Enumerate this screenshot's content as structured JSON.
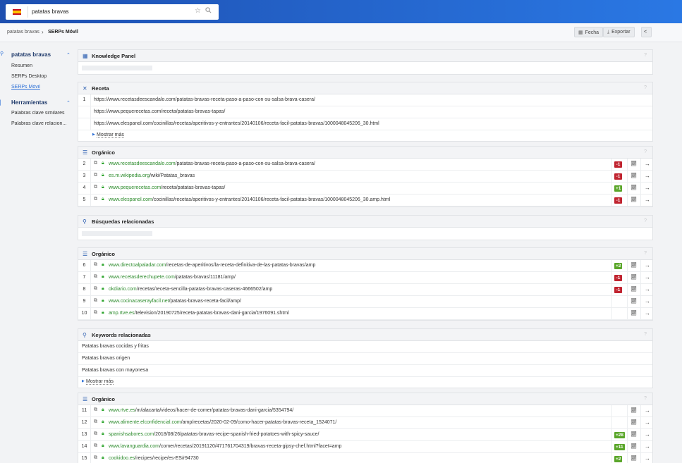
{
  "topbar": {
    "search_value": "patatas bravas",
    "flag_icon": "spain-flag-icon",
    "brand_color": "#2a6ed6"
  },
  "breadcrumb": {
    "item1": "patatas bravas",
    "separator": "›",
    "item2": "SERPs Móvil"
  },
  "toolbar": {
    "date_label": "Fecha",
    "export_label": "Exportar"
  },
  "sidebar": {
    "section1_title": "patatas bravas",
    "items": [
      "Resumen",
      "SERPs Desktop",
      "SERPs Móvil"
    ],
    "section2_title": "Herramientas",
    "tools": [
      "Palabras clave similares",
      "Palabras clave relacion..."
    ]
  },
  "panels": {
    "knowledge": {
      "title": "Knowledge Panel",
      "help": "?"
    },
    "receta": {
      "title": "Receta",
      "help": "?",
      "position": "1",
      "urls": [
        "https://www.recetasdeescandalo.com/patatas-bravas-receta-paso-a-paso-con-su-salsa-brava-casera/",
        "https://www.pequerecetas.com/receta/patatas-bravas-tapas/",
        "https://www.elespanol.com/cocinillas/recetas/aperitivos-y-entrantes/20140106/receta-facil-patatas-bravas/1000048045206_30.html"
      ],
      "more_label": "Mostrar más"
    },
    "organic1": {
      "title": "Orgánico",
      "help": "?",
      "rows": [
        {
          "num": "2",
          "domain": "www.recetasdeescandalo.com",
          "path": "/patatas-bravas-receta-paso-a-paso-con-su-salsa-brava-casera/",
          "badge": "-1"
        },
        {
          "num": "3",
          "domain": "es.m.wikipedia.org",
          "path": "/wiki/Patatas_bravas",
          "badge": "-1"
        },
        {
          "num": "4",
          "domain": "www.pequerecetas.com",
          "path": "/receta/patatas-bravas-tapas/",
          "badge": "+1"
        },
        {
          "num": "5",
          "domain": "www.elespanol.com",
          "path": "/cocinillas/recetas/aperitivos-y-entrantes/20140106/receta-facil-patatas-bravas/1000048045206_30.amp.html",
          "badge": "-1"
        }
      ]
    },
    "busquedas": {
      "title": "Búsquedas relacionadas",
      "help": "?"
    },
    "organic2": {
      "title": "Orgánico",
      "help": "?",
      "rows": [
        {
          "num": "6",
          "domain": "www.directoalpaladar.com",
          "path": "/recetas-de-aperitivos/la-receta-definitiva-de-las-patatas-bravas/amp",
          "badge": "+2"
        },
        {
          "num": "7",
          "domain": "www.recetasderechupete.com",
          "path": "/patatas-bravas/11181/amp/",
          "badge": "-1"
        },
        {
          "num": "8",
          "domain": "okdiario.com",
          "path": "/recetas/receta-sencilla-patatas-bravas-caseras-4666502/amp",
          "badge": "-1"
        },
        {
          "num": "9",
          "domain": "www.cocinacaserayfacil.net",
          "path": "/patatas-bravas-receta-facil/amp/",
          "badge": ""
        },
        {
          "num": "10",
          "domain": "amp.rtve.es",
          "path": "/television/20190725/receta-patatas-bravas-dani-garcia/1976091.shtml",
          "badge": ""
        }
      ]
    },
    "keywords": {
      "title": "Keywords relacionadas",
      "help": "?",
      "items": [
        "Patatas bravas cocidas y fritas",
        "Patatas bravas origen",
        "Patatas bravas con mayonesa"
      ],
      "more_label": "Mostrar más"
    },
    "organic3": {
      "title": "Orgánico",
      "help": "?",
      "rows": [
        {
          "num": "11",
          "domain": "www.rtve.es",
          "path": "/m/alacarta/videos/hacer-de-comer/patatas-bravas-dani-garcia/5354794/",
          "badge": ""
        },
        {
          "num": "12",
          "domain": "www.alimente.elconfidencial.com",
          "path": "/amp/recetas/2020-02-09/como-hacer-patatas-bravas-receta_1524071/",
          "badge": ""
        },
        {
          "num": "13",
          "domain": "spanishsabores.com",
          "path": "/2018/08/26/patatas-bravas-recipe-spanish-fried-potatoes-with-spicy-sauce/",
          "badge": "+28"
        },
        {
          "num": "14",
          "domain": "www.lavanguardia.com",
          "path": "/comer/recetas/20191120/471761704319/bravas-receta-gipsy-chef.html?facet=amp",
          "badge": "+11"
        },
        {
          "num": "15",
          "domain": "cookidoo.es",
          "path": "/recipes/recipe/es-ES/r94730",
          "badge": "+2"
        }
      ]
    }
  }
}
